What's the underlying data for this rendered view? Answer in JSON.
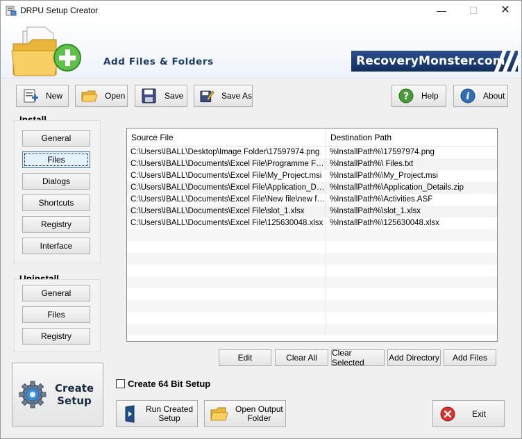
{
  "window": {
    "title": "DRPU Setup Creator",
    "minimize": "—",
    "maximize": "☐",
    "close": "✕"
  },
  "banner": {
    "title": "Add Files & Folders",
    "brand": "RecoveryMonster.com"
  },
  "toolbar": {
    "new": "New",
    "open": "Open",
    "save": "Save",
    "save_as": "Save As",
    "help": "Help",
    "about": "About"
  },
  "install": {
    "label": "Install",
    "items": [
      "General",
      "Files",
      "Dialogs",
      "Shortcuts",
      "Registry",
      "Interface"
    ],
    "active": "Files"
  },
  "uninstall": {
    "label": "Uninstall",
    "items": [
      "General",
      "Files",
      "Registry"
    ]
  },
  "file_list": {
    "columns": [
      "Source File",
      "Destination Path"
    ],
    "rows": [
      [
        "C:\\Users\\IBALL\\Desktop\\Image Folder\\17597974.png",
        "%InstallPath%\\17597974.png"
      ],
      [
        "C:\\Users\\IBALL\\Documents\\Excel File\\Programme Files.txt",
        "%InstallPath%\\ Files.txt"
      ],
      [
        "C:\\Users\\IBALL\\Documents\\Excel File\\My_Project.msi",
        "%InstallPath%\\My_Project.msi"
      ],
      [
        "C:\\Users\\IBALL\\Documents\\Excel File\\Application_Details.zip",
        "%InstallPath%\\Application_Details.zip"
      ],
      [
        "C:\\Users\\IBALL\\Documents\\Excel File\\New file\\new file\\Activities.ASF",
        "%InstallPath%\\Activities.ASF"
      ],
      [
        "C:\\Users\\IBALL\\Documents\\Excel File\\slot_1.xlsx",
        "%InstallPath%\\slot_1.xlsx"
      ],
      [
        "C:\\Users\\IBALL\\Documents\\Excel File\\125630048.xlsx",
        "%InstallPath%\\125630048.xlsx"
      ]
    ]
  },
  "list_actions": {
    "edit": "Edit",
    "clear_all": "Clear All",
    "clear_selected": "Clear Selected",
    "add_directory": "Add Directory",
    "add_files": "Add Files"
  },
  "options": {
    "create_64bit": "Create 64 Bit Setup",
    "create_64bit_checked": false
  },
  "bottom": {
    "create_setup_line1": "Create",
    "create_setup_line2": "Setup",
    "run_created_line1": "Run Created",
    "run_created_line2": "Setup",
    "open_output_line1": "Open Output",
    "open_output_line2": "Folder",
    "exit": "Exit"
  },
  "colors": {
    "brand_bg": "#173a70",
    "banner_title": "#1f3b63",
    "help_green": "#4a9a3a",
    "about_blue": "#2f6db5",
    "exit_red": "#d8322a"
  }
}
